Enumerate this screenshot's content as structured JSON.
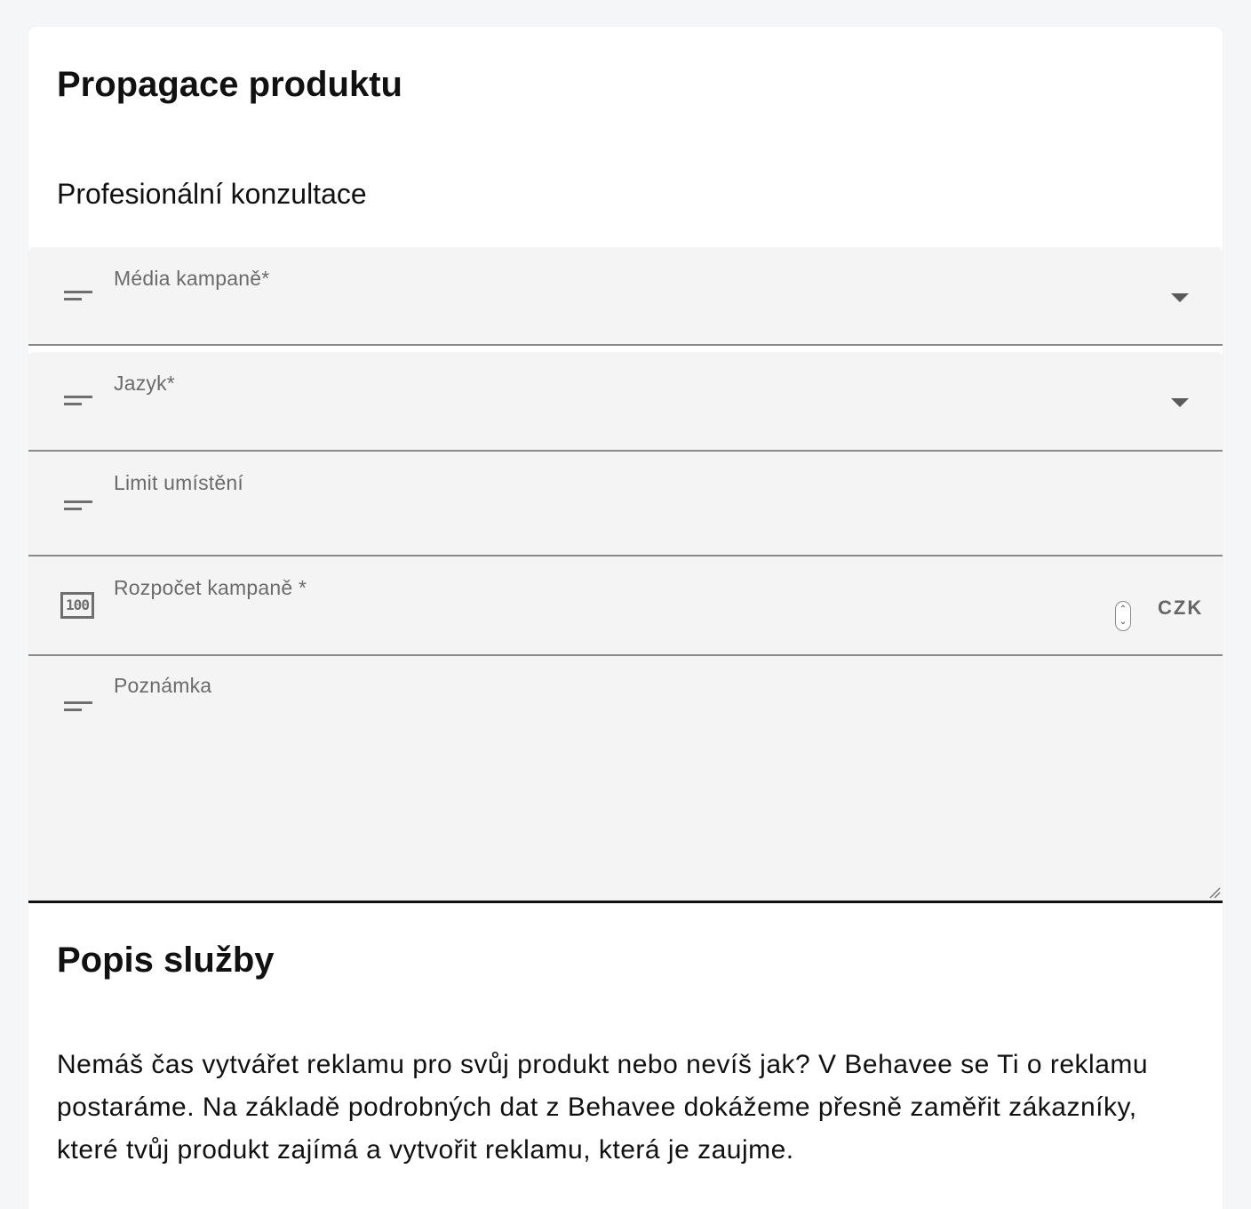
{
  "form": {
    "title": "Propagace produktu",
    "subtitle": "Profesionální konzultace",
    "fields": {
      "media": {
        "label": "Média kampaně*",
        "icon": "short-text-icon",
        "type": "select",
        "value": ""
      },
      "language": {
        "label": "Jazyk*",
        "icon": "short-text-icon",
        "type": "select",
        "value": ""
      },
      "placement_limit": {
        "label": "Limit umístění",
        "icon": "short-text-icon",
        "type": "text",
        "value": ""
      },
      "budget": {
        "label": "Rozpočet kampaně *",
        "icon": "number-counter-icon",
        "icon_text": "100",
        "type": "number",
        "value": "",
        "currency": "CZK"
      },
      "note": {
        "label": "Poznámka",
        "icon": "short-text-icon",
        "type": "textarea",
        "value": ""
      }
    }
  },
  "service": {
    "title": "Popis služby",
    "description": "Nemáš čas vytvářet reklamu pro svůj produkt nebo nevíš jak? V Behavee se Ti o reklamu postaráme. Na základě podrobných dat z Behavee dokážeme přesně zaměřit zákazníky, které tvůj produkt zajímá a vytvořit reklamu, která je zaujme."
  },
  "colors": {
    "page_background": "#f5f6f8",
    "card_background": "#ffffff",
    "field_background": "#f4f4f4",
    "label_color": "#6b6b6b",
    "icon_color": "#6f6f6f"
  }
}
